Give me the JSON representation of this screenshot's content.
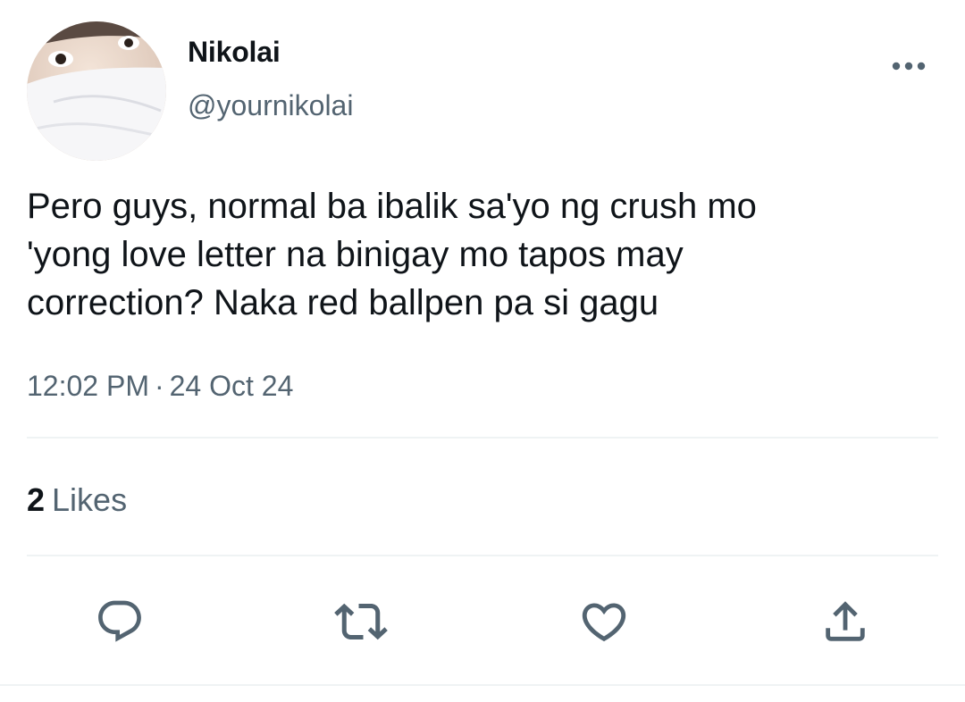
{
  "author": {
    "display_name": "Nikolai",
    "handle": "@yournikolai"
  },
  "tweet": {
    "text": "Pero guys, normal ba ibalik sa'yo ng crush mo\n'yong love letter na binigay mo tapos may\ncorrection? Naka red ballpen pa si gagu",
    "time": "12:02 PM",
    "separator": "·",
    "date": "24 Oct 24"
  },
  "stats": {
    "likes_count": "2",
    "likes_label": "Likes"
  },
  "icons": {
    "more": "more-horizontal-icon",
    "reply": "reply-icon",
    "retweet": "retweet-icon",
    "like": "heart-icon",
    "share": "share-icon"
  },
  "colors": {
    "text_primary": "#0f1419",
    "text_secondary": "#536471",
    "divider": "#eff3f4",
    "icon": "#536471"
  }
}
